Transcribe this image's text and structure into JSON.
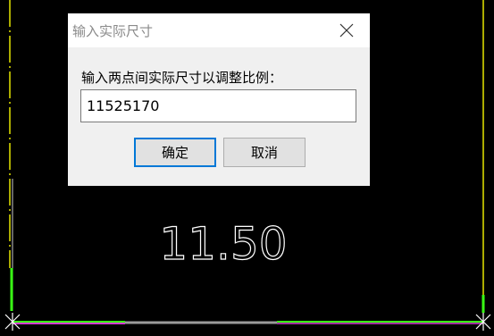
{
  "dialog": {
    "title": "输入实际尺寸",
    "prompt": "输入两点间实际尺寸以调整比例：",
    "input_value": "11525170",
    "ok_label": "确定",
    "cancel_label": "取消",
    "close_icon": "close-icon"
  },
  "drawing": {
    "dimension_text": "11.50"
  },
  "colors": {
    "background": "#000000",
    "line_yellow": "#e6e600",
    "line_green": "#39ff14",
    "line_magenta": "#d43bd4",
    "line_gray": "#9a9a9a",
    "text_white": "#ffffff",
    "dialog_bg": "#f0f0f0",
    "accent_blue": "#0078d7"
  }
}
